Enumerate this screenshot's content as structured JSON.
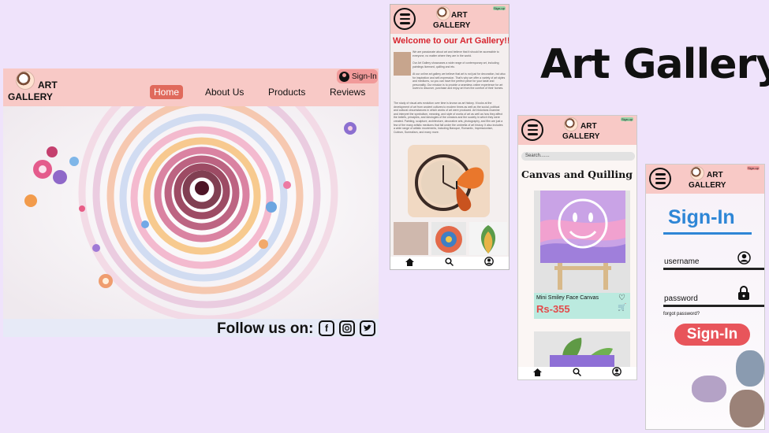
{
  "title": "Art Gallery",
  "logo": {
    "line1": "ART",
    "line2": "GALLERY"
  },
  "desktop": {
    "signin_label": "Sign-In",
    "nav": [
      "Home",
      "About Us",
      "Products",
      "Reviews"
    ],
    "follow_label": "Follow us on:",
    "social_icons": [
      "facebook-icon",
      "instagram-icon",
      "twitter-icon"
    ]
  },
  "phone_home": {
    "welcome": "Welcome to our Art Gallery!!",
    "intro_1": "We are passionate about art and believe that it should be accessible to everyone, no matter where they are in the world.",
    "intro_2": "Our Art Gallery showcases a wide range of contemporary art, including paintings licensed, quilling and etc.",
    "intro_3": "At our online art gallery we believe that art is not just for decoration, but also for inspiration and self-expression. That's why we offer a variety of art styles and mediums, so you can have the perfect piece for your taste and personality. Our mission is to provide a seamless online experience for art lovers to discover, purchase and enjoy art from the comfort of their homes.",
    "intro_4": "The study of visual arts evolution over time is known as art history. It looks at the development of art from ancient cultures to modern times as well as the social, political and cultural circumstances in which works of art were produced. Art historians examine and interpret the symbolism, meaning, and style of works of art as well as how they affect the beliefs, principles, and ideologies of the creators and the society in which they were created. Painting, sculpture, architecture, decorative arts, photography, and film are just a few of the many artistic mediums that fall under the umbrella of art history. It also includes a wide range of artistic movements, including Baroque, Romantic, Impressionism, Cubism, Surrealism, and many more.",
    "badge": "Sign-up"
  },
  "phone_products": {
    "search_placeholder": "Search.......",
    "category": "Canvas and Quilling",
    "product_name": "Mini Smiley Face Canvas",
    "product_price": "Rs-355",
    "badge": "Sign-up"
  },
  "phone_signin": {
    "title": "Sign-In",
    "username_label": "username",
    "password_label": "password",
    "forgot": "forgot password?",
    "button": "Sign-In",
    "badge": "Sign-up"
  },
  "colors": {
    "header": "#f8c9c6",
    "accent_red": "#e8555b",
    "accent_blue": "#2e86d6",
    "background": "#efe3fb"
  }
}
